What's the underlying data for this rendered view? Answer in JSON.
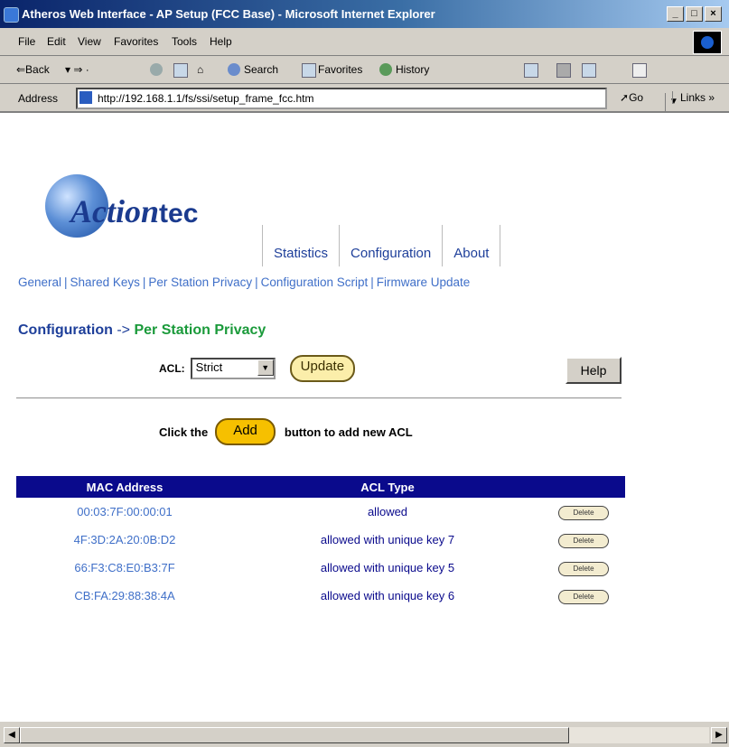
{
  "window": {
    "title": "Atheros Web Interface - AP Setup (FCC Base) - Microsoft Internet Explorer",
    "buttons": [
      "_",
      "□",
      "×"
    ]
  },
  "menubar": [
    "File",
    "Edit",
    "View",
    "Favorites",
    "Tools",
    "Help"
  ],
  "toolbar": {
    "back": "⇐Back",
    "search": "Search",
    "favorites": "Favorites",
    "history": "History"
  },
  "addressbar": {
    "label": "Address",
    "url": "http://192.168.1.1/fs/ssi/setup_frame_fcc.htm",
    "go": "Go",
    "links": "Links »"
  },
  "logo": {
    "brand_a": "Action",
    "brand_b": "tec"
  },
  "topnav": [
    "Statistics",
    "Configuration",
    "About"
  ],
  "subnav": [
    "General",
    "Shared Keys",
    "Per Station Privacy",
    "Configuration Script",
    "Firmware Update"
  ],
  "breadcrumb": {
    "section": "Configuration",
    "arrow": "->",
    "page": "Per Station Privacy"
  },
  "acl": {
    "label": "ACL:",
    "selected": "Strict",
    "update_label": "Update",
    "help_label": "Help"
  },
  "add": {
    "prefix": "Click the",
    "button": "Add",
    "suffix": "button to add new ACL"
  },
  "table": {
    "headers": [
      "MAC Address",
      "ACL Type",
      ""
    ],
    "delete_label": "Delete",
    "rows": [
      {
        "mac": "00:03:7F:00:00:01",
        "type": "allowed"
      },
      {
        "mac": "4F:3D:2A:20:0B:D2",
        "type": "allowed with unique key 7"
      },
      {
        "mac": "66:F3:C8:E0:B3:7F",
        "type": "allowed with unique key 5"
      },
      {
        "mac": "CB:FA:29:88:38:4A",
        "type": "allowed with unique key 6"
      }
    ]
  },
  "colors": {
    "header_bg": "#0a0a8c",
    "link": "#3f6fc8",
    "breadcrumb_page": "#1a9a3a",
    "add_button": "#f6c000"
  }
}
